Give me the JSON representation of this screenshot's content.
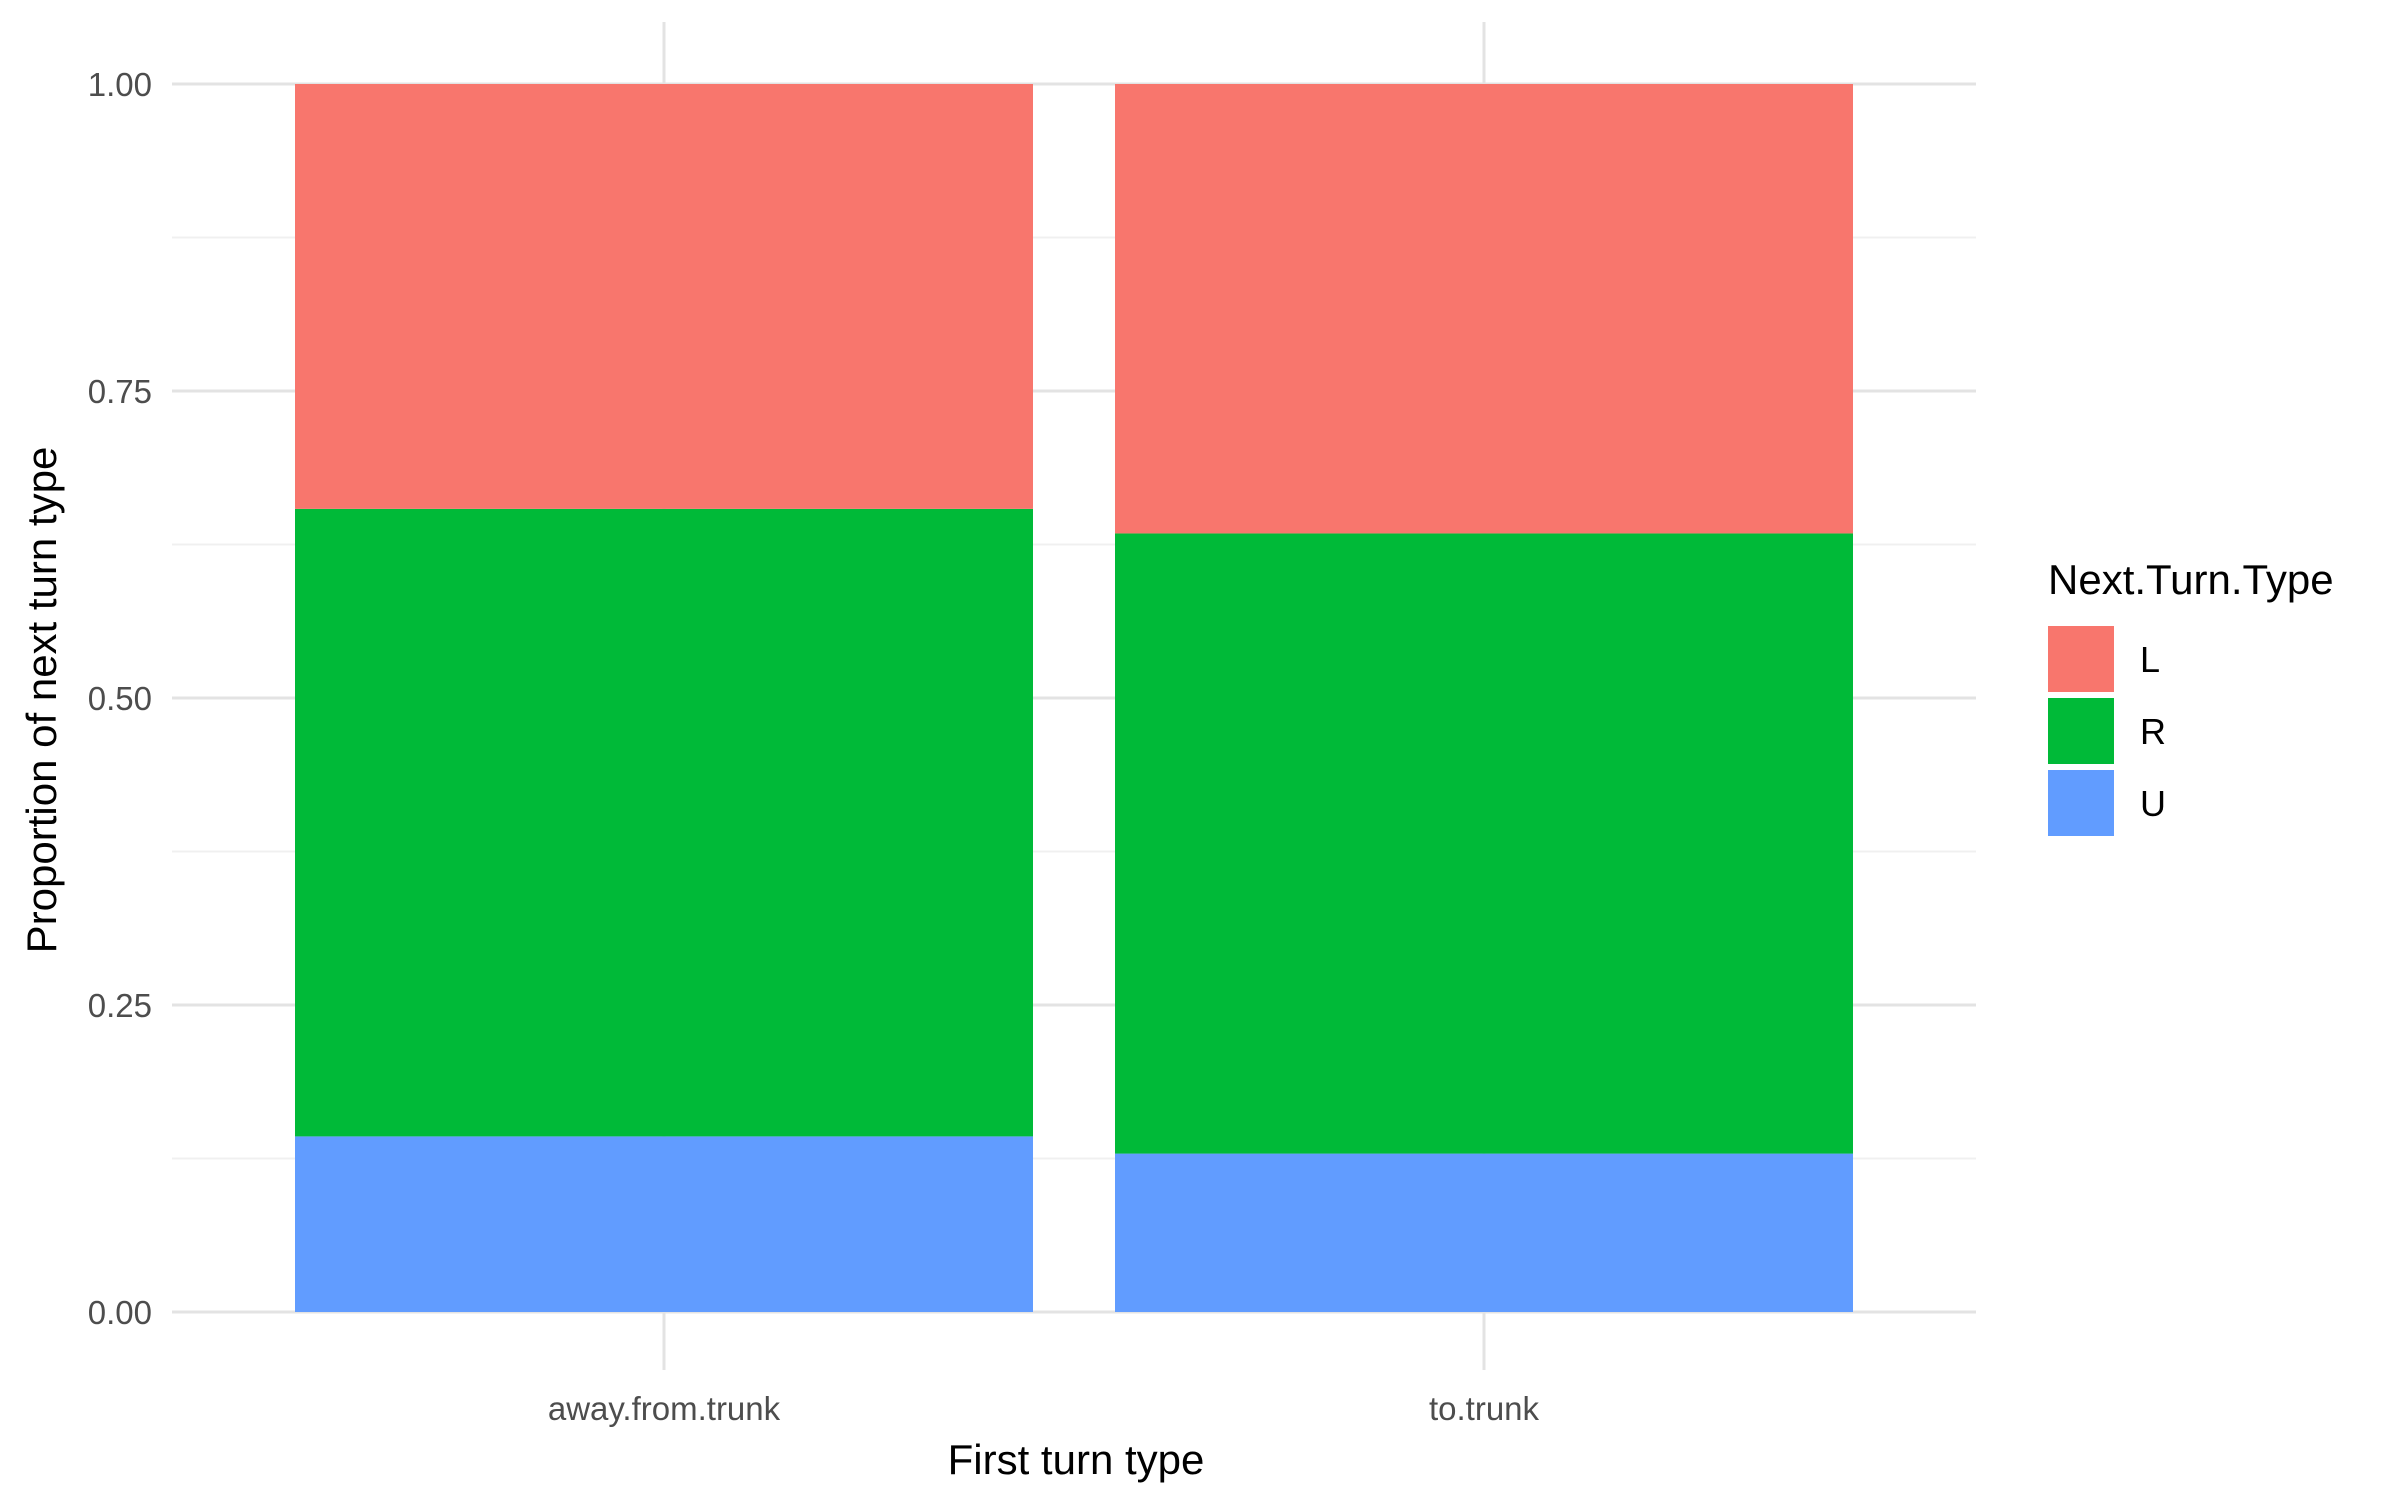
{
  "chart_data": {
    "type": "bar",
    "stacked": true,
    "title": "",
    "xlabel": "First turn type",
    "ylabel": "Proportion of next turn type",
    "categories": [
      "away.from.trunk",
      "to.trunk"
    ],
    "series": [
      {
        "name": "L",
        "color": "#F8766D",
        "values": [
          0.346,
          0.366
        ]
      },
      {
        "name": "R",
        "color": "#00BA38",
        "values": [
          0.511,
          0.505
        ]
      },
      {
        "name": "U",
        "color": "#619CFF",
        "values": [
          0.143,
          0.129
        ]
      }
    ],
    "ylim": [
      0,
      1
    ],
    "yticks": [
      "0.00",
      "0.25",
      "0.50",
      "0.75",
      "1.00"
    ],
    "grid": true,
    "legend": {
      "title": "Next.Turn.Type",
      "position": "right"
    }
  }
}
